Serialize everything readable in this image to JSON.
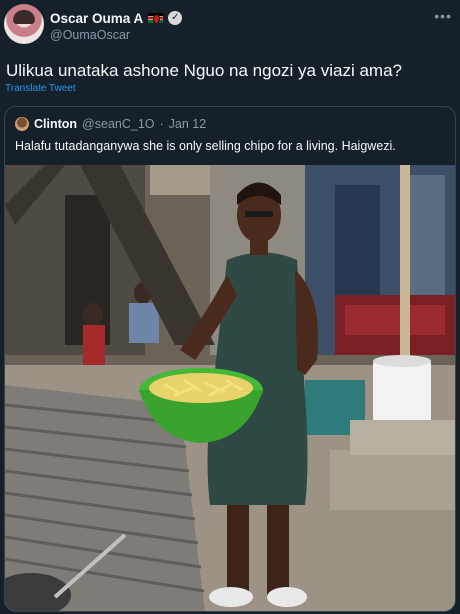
{
  "author": {
    "name": "Oscar Ouma A",
    "handle": "@OumaOscar",
    "verified_mark": "✓",
    "flag_icon": "kenya-flag-icon"
  },
  "more_label": "•••",
  "tweet": {
    "text": "Ulikua unataka ashone Nguo na ngozi ya viazi ama?",
    "translate_label": "Translate Tweet"
  },
  "quoted": {
    "name": "Clinton",
    "handle": "@seanC_1O",
    "separator": "·",
    "date": "Jan 12",
    "text": "Halafu tutadanganywa she is only selling chipo for a living. Haigwezi."
  },
  "colors": {
    "background": "#15202b",
    "link": "#1d9bf0",
    "secondary_text": "#8b98a5",
    "border": "#38444d"
  }
}
